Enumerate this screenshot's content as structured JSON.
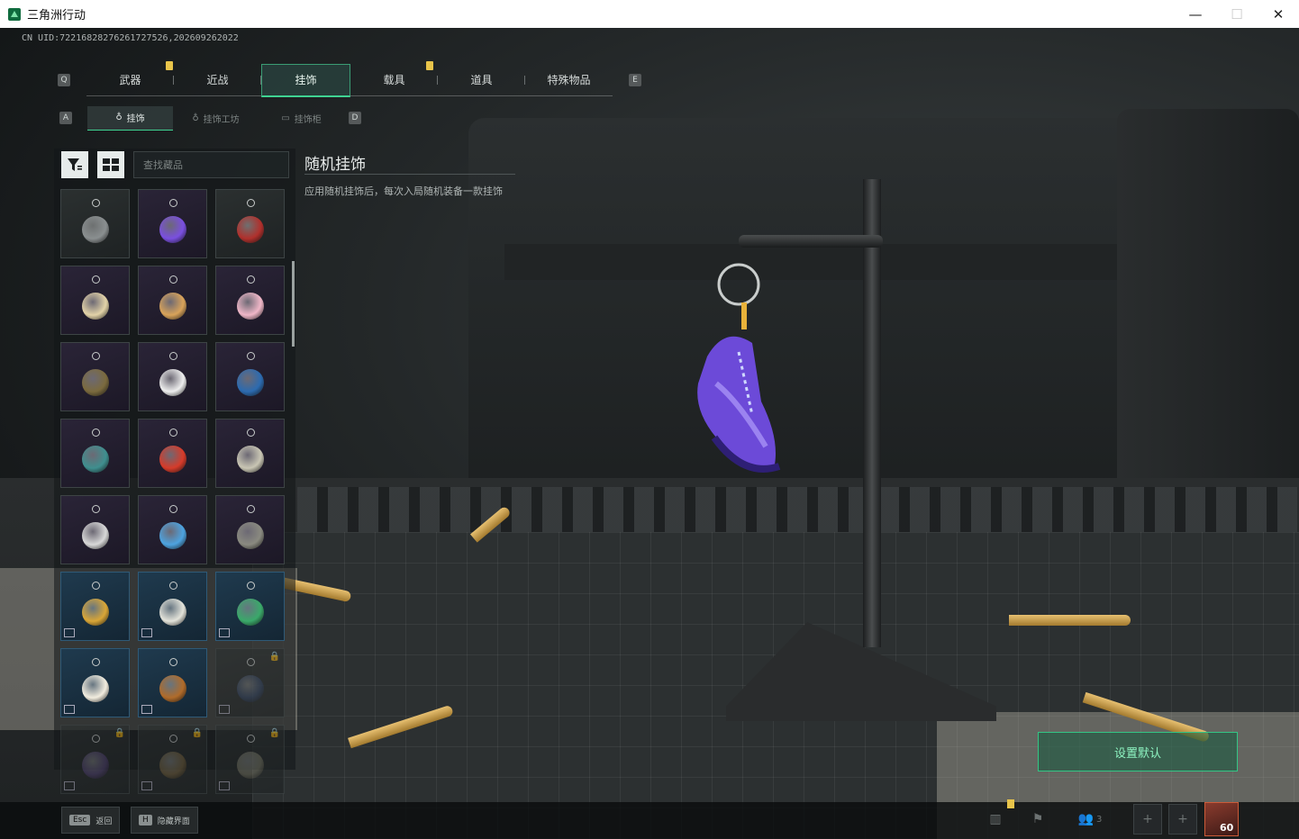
{
  "window": {
    "title": "三角洲行动",
    "controls": {
      "minimize": "—",
      "maximize": "☐",
      "close": "✕"
    }
  },
  "uid": "CN UID:7221682827626172752​6,202609262022",
  "primary_tabs": {
    "left_key": "Q",
    "right_key": "E",
    "items": [
      {
        "label": "武器",
        "badge": true
      },
      {
        "label": "近战",
        "badge": false
      },
      {
        "label": "挂饰",
        "badge": false,
        "active": true
      },
      {
        "label": "载具",
        "badge": true
      },
      {
        "label": "道具",
        "badge": false
      },
      {
        "label": "特殊物品",
        "badge": false
      }
    ]
  },
  "secondary_tabs": {
    "left_key": "A",
    "right_key": "D",
    "items": [
      {
        "label": "挂饰",
        "active": true
      },
      {
        "label": "挂饰工坊",
        "active": false
      },
      {
        "label": "挂饰柜",
        "active": false
      }
    ]
  },
  "search": {
    "placeholder": "查找藏品"
  },
  "detail": {
    "title": "随机挂饰",
    "description": "应用随机挂饰后，每次入局随机装备一款挂饰"
  },
  "items_grid": [
    {
      "charm": "gray-hat-charm",
      "color": "#8a8f90",
      "tier": "default"
    },
    {
      "charm": "purple-sneaker-charm",
      "color": "#7a4fe0",
      "tier": "purple"
    },
    {
      "charm": "red-rose-charm",
      "color": "#b0302c",
      "tier": "default"
    },
    {
      "charm": "flower-bouquet-charm",
      "color": "#e3d3a8",
      "tier": "purple"
    },
    {
      "charm": "cookie-charm",
      "color": "#d9a35a",
      "tier": "purple"
    },
    {
      "charm": "cupcake-charm",
      "color": "#f0b7c8",
      "tier": "purple"
    },
    {
      "charm": "bronze-medal-charm",
      "color": "#7b6a3e",
      "tier": "purple"
    },
    {
      "charm": "white-duck-charm",
      "color": "#eeeeee",
      "tier": "purple"
    },
    {
      "charm": "blue-shirt-charm",
      "color": "#2c6bb0",
      "tier": "purple"
    },
    {
      "charm": "crystal-charm",
      "color": "#3f8f8f",
      "tier": "purple"
    },
    {
      "charm": "fries-charm",
      "color": "#d63b2a",
      "tier": "purple"
    },
    {
      "charm": "silver-bird-charm",
      "color": "#c9c6b4",
      "tier": "purple"
    },
    {
      "charm": "chess-piece-charm",
      "color": "#d8d8d8",
      "tier": "purple"
    },
    {
      "charm": "blue-card-charm",
      "color": "#4da3e0",
      "tier": "purple"
    },
    {
      "charm": "gray-pouch-charm",
      "color": "#8a8a80",
      "tier": "purple"
    },
    {
      "charm": "gold-orb-charm",
      "color": "#d9a637",
      "tier": "blue"
    },
    {
      "charm": "mahjong-tile-charm",
      "color": "#e3e3da",
      "tier": "blue"
    },
    {
      "charm": "dice-tile-charm",
      "color": "#3aa96a",
      "tier": "blue"
    },
    {
      "charm": "porcelain-vase-charm",
      "color": "#f2eddf",
      "tier": "blue"
    },
    {
      "charm": "wooden-wheel-charm",
      "color": "#b06b2a",
      "tier": "blue"
    },
    {
      "charm": "locked-frame-charm",
      "color": "#2d3e5a",
      "tier": "locked"
    },
    {
      "charm": "locked-badge-charm",
      "color": "#4b3e6a",
      "tier": "locked"
    },
    {
      "charm": "locked-lantern-charm",
      "color": "#6a5a3a",
      "tier": "locked"
    },
    {
      "charm": "locked-sculpt-charm",
      "color": "#6a6a5a",
      "tier": "locked"
    }
  ],
  "actions": {
    "set_default": "设置默认"
  },
  "bottom_hints": [
    {
      "key": "Esc",
      "label": "返回"
    },
    {
      "key": "H",
      "label": "隐藏界面"
    }
  ],
  "status": {
    "friends_count": "3",
    "level": "60"
  },
  "colors": {
    "accent": "#3fd392",
    "badge": "#e8c44a"
  }
}
